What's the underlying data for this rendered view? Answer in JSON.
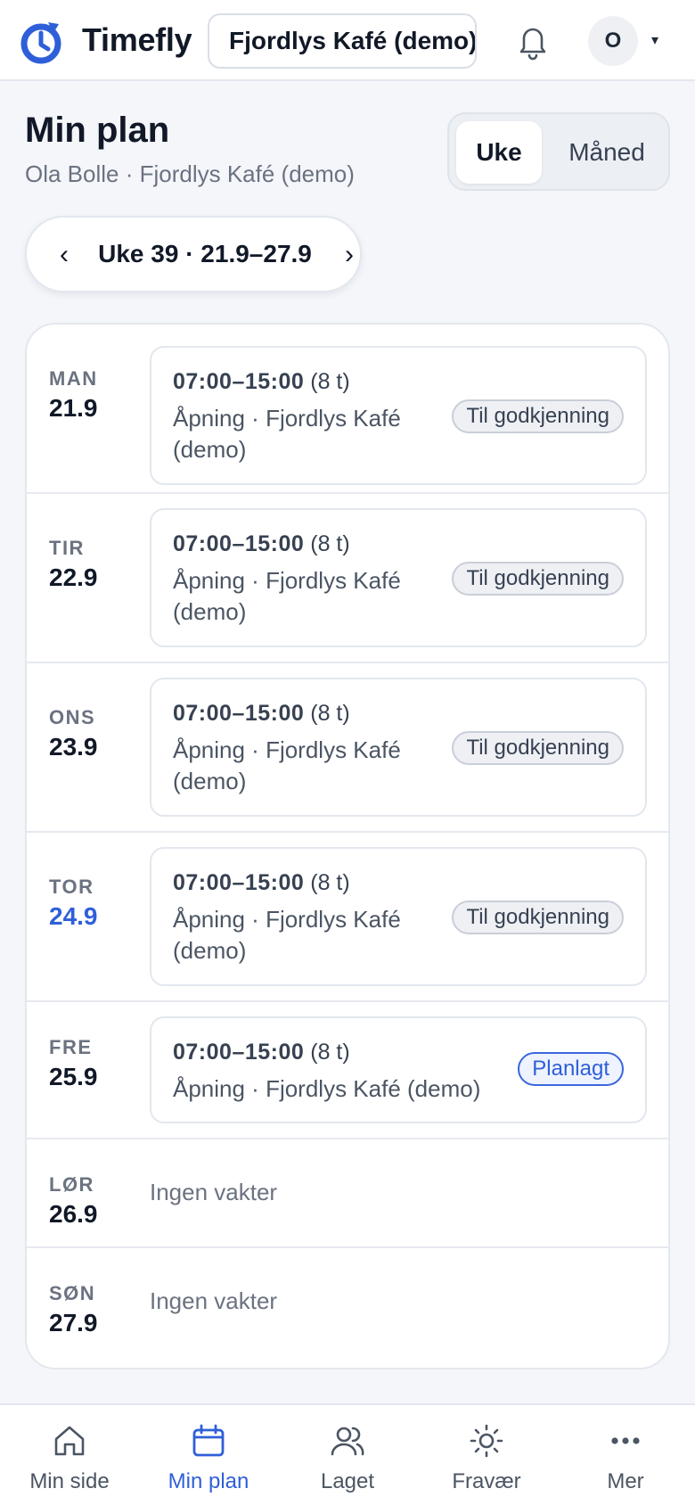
{
  "header": {
    "app_name": "Timefly",
    "workspace": "Fjordlys Kafé (demo)",
    "avatar_initial": "O",
    "avatar_caret": "▾"
  },
  "page": {
    "title": "Min plan",
    "subtitle": "Ola Bolle · Fjordlys Kafé (demo)",
    "view_toggle": {
      "week": "Uke",
      "month": "Måned",
      "selected": "week"
    },
    "week_nav": {
      "prev": "‹",
      "label": "Uke 39 · 21.9–27.9",
      "next": "›"
    }
  },
  "days": [
    {
      "name": "MAN",
      "date": "21.9",
      "shift": {
        "time": "07:00–15:00",
        "hours": "(8 t)",
        "place": "Åpning · Fjordlys Kafé (demo)",
        "status": "Til godkjenning"
      }
    },
    {
      "name": "TIR",
      "date": "22.9",
      "shift": {
        "time": "07:00–15:00",
        "hours": "(8 t)",
        "place": "Åpning · Fjordlys Kafé (demo)",
        "status": "Til godkjenning"
      }
    },
    {
      "name": "ONS",
      "date": "23.9",
      "shift": {
        "time": "07:00–15:00",
        "hours": "(8 t)",
        "place": "Åpning · Fjordlys Kafé (demo)",
        "status": "Til godkjenning"
      }
    },
    {
      "name": "TOR",
      "date": "24.9",
      "today": true,
      "shift": {
        "time": "07:00–15:00",
        "hours": "(8 t)",
        "place": "Åpning · Fjordlys Kafé (demo)",
        "status": "Til godkjenning"
      }
    },
    {
      "name": "FRE",
      "date": "25.9",
      "shift": {
        "time": "07:00–15:00",
        "hours": "(8 t)",
        "place": "Åpning · Fjordlys Kafé (demo)",
        "status": "Planlagt"
      }
    },
    {
      "name": "LØR",
      "date": "26.9",
      "no_shift": "Ingen vakter"
    },
    {
      "name": "SØN",
      "date": "27.9",
      "no_shift": "Ingen vakter"
    }
  ],
  "bottom_nav": [
    {
      "label": "Min side",
      "icon": "home-icon"
    },
    {
      "label": "Min plan",
      "icon": "calendar-icon",
      "active": true
    },
    {
      "label": "Laget",
      "icon": "team-icon"
    },
    {
      "label": "Fravær",
      "icon": "sun-icon"
    },
    {
      "label": "Mer",
      "icon": "more-icon"
    }
  ],
  "colors": {
    "accent": "#2f5fd8",
    "background": "#f4f6fa",
    "pending_badge_border": "#c9ced8",
    "planned_badge_border": "#3b66dd"
  }
}
